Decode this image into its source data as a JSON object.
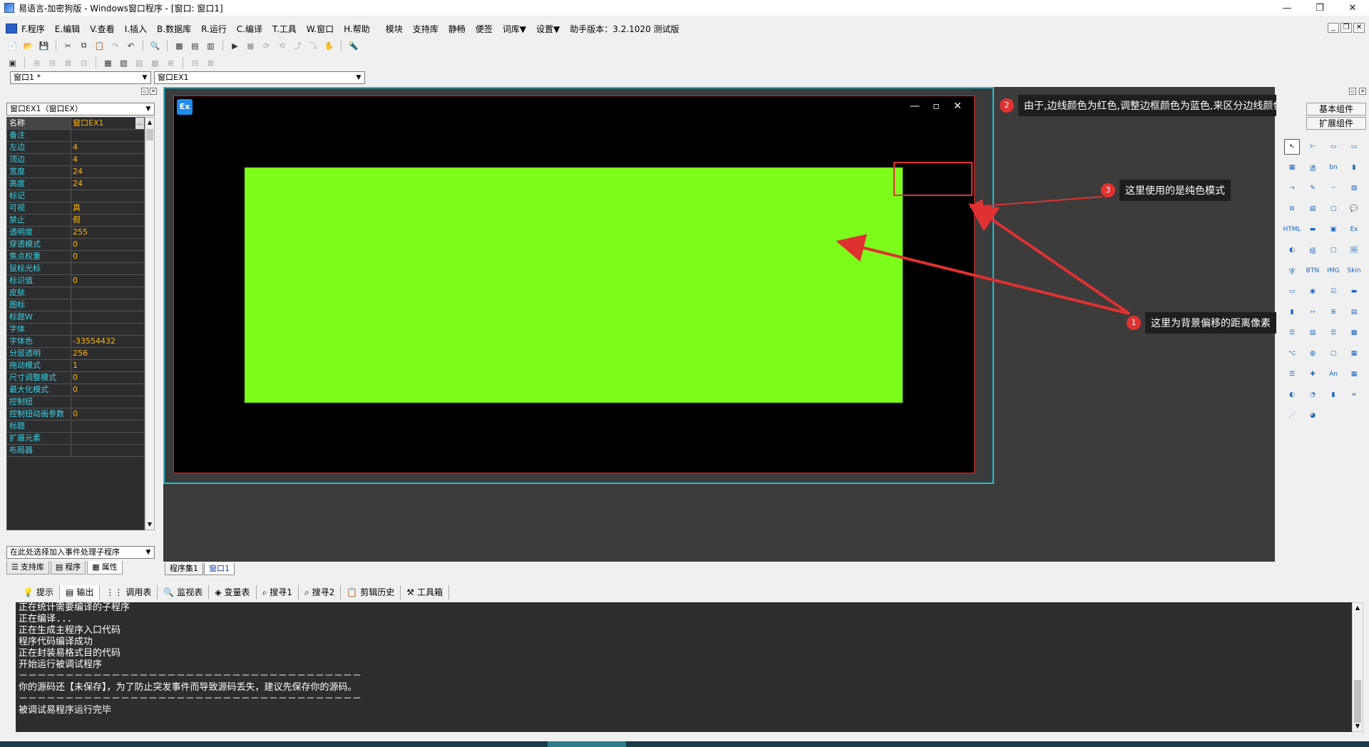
{
  "window": {
    "title": "易语言-加密狗版 - Windows窗口程序 - [窗口: 窗口1]",
    "controls": [
      "—",
      "❐",
      "✕"
    ]
  },
  "menu": {
    "items": [
      "F.程序",
      "E.编辑",
      "V.查看",
      "I.插入",
      "B.数据库",
      "R.运行",
      "C.编译",
      "T.工具",
      "W.窗口",
      "H.帮助",
      "模块",
      "支持库",
      "静畅",
      "便签",
      "词库▼",
      "设置▼",
      "助手版本：3.2.1020 测试版"
    ]
  },
  "toolbar1": [
    "📄",
    "📂",
    "💾",
    "✂",
    "⧉",
    "📋",
    "↷",
    "↶",
    "🔍",
    "▦",
    "▤",
    "▥",
    "▶",
    "■",
    "⟳",
    "⟲",
    "⤴",
    "⤵",
    "✋",
    "🔦"
  ],
  "toolbar2": [
    "▣",
    "⊞",
    "⊟",
    "⊠",
    "⊡",
    "▦",
    "▧",
    "▨",
    "▩",
    "⊞",
    "⊟",
    "⊠"
  ],
  "combos": {
    "window_select": "窗口1 *",
    "component_select": "窗口EX1"
  },
  "left_panel": {
    "object_combo": "窗口EX1（窗口EX）",
    "properties": [
      {
        "name": "名称",
        "value": "窗口EX1"
      },
      {
        "name": "备注",
        "value": ""
      },
      {
        "name": "左边",
        "value": "4"
      },
      {
        "name": "顶边",
        "value": "4"
      },
      {
        "name": "宽度",
        "value": "24"
      },
      {
        "name": "高度",
        "value": "24"
      },
      {
        "name": "标记",
        "value": ""
      },
      {
        "name": "可视",
        "value": "真"
      },
      {
        "name": "禁止",
        "value": "假"
      },
      {
        "name": "透明度",
        "value": "255"
      },
      {
        "name": "穿透模式",
        "value": "0"
      },
      {
        "name": "焦点权重",
        "value": "0"
      },
      {
        "name": "鼠标光标",
        "value": ""
      },
      {
        "name": "标识值",
        "value": "0"
      },
      {
        "name": "皮肤",
        "value": ""
      },
      {
        "name": "图标",
        "value": ""
      },
      {
        "name": "标题W",
        "value": ""
      },
      {
        "name": "字体",
        "value": ""
      },
      {
        "name": "字体色",
        "value": "-33554432"
      },
      {
        "name": "分层透明",
        "value": "256"
      },
      {
        "name": "拖动模式",
        "value": "1"
      },
      {
        "name": "尺寸调整模式",
        "value": "0"
      },
      {
        "name": "最大化模式",
        "value": "0"
      },
      {
        "name": "控制钮",
        "value": ""
      },
      {
        "name": "控制钮动画参数",
        "value": "0"
      },
      {
        "name": "标题",
        "value": ""
      },
      {
        "name": "扩展元素",
        "value": ""
      },
      {
        "name": "布局器",
        "value": ""
      }
    ],
    "event_combo": "在此处选择加入事件处理子程序",
    "tabs": [
      "支持库",
      "程序",
      "属性"
    ]
  },
  "design": {
    "window_icon_text": "Ex",
    "window_buttons": [
      "—",
      "▫",
      "✕"
    ],
    "colors": {
      "frame": "#19c2d6",
      "border": "#d22b2b",
      "background": "#000000",
      "fill": "#7cfc1a",
      "annotation": "#e03131"
    }
  },
  "doc_tabs": [
    "程序集1",
    "窗口1"
  ],
  "annotations": [
    {
      "num": "1",
      "text": "这里为背景偏移的距离像素"
    },
    {
      "num": "2",
      "text": "由于,边线颜色为红色,调整边框颜色为蓝色,来区分边线颜色"
    },
    {
      "num": "3",
      "text": "这里使用的是纯色模式"
    }
  ],
  "right_panel": {
    "tab_basic": "基本组件",
    "tab_ext": "扩展组件",
    "palette": [
      "↖",
      "⊢",
      "▭",
      "▭",
      "▦",
      "透",
      "bn",
      "▮",
      "⇢",
      "✎",
      "┄",
      "▨",
      "⧉",
      "▤",
      "▢",
      "💬",
      "HTML",
      "▬",
      "▣",
      "Ex",
      "◐",
      "组",
      "▢",
      "🖼",
      "字",
      "BTN",
      "IMG",
      "Skin",
      "▭",
      "◉",
      "☑",
      "▬",
      "▮",
      "⇿",
      "≣",
      "▤",
      "☰",
      "▤",
      "☰",
      "▩",
      "⌥",
      "◍",
      "▢",
      "▦",
      "☰",
      "✚",
      "An",
      "▦",
      "◐",
      "◔",
      "▮",
      "≈",
      "⋰",
      "◕"
    ]
  },
  "output": {
    "tabs": [
      "提示",
      "输出",
      "调用表",
      "监视表",
      "变量表",
      "搜寻1",
      "搜寻2",
      "剪辑历史",
      "工具箱"
    ],
    "active_tab": "输出",
    "lines": [
      "正在统计需要编译的子程序",
      "正在编译...",
      "正在生成主程序入口代码",
      "程序代码编译成功",
      "正在封装易格式目的代码",
      "开始运行被调试程序",
      "－－－－－－－－－－－－－－－－－－－－－－－－－－－－－－－－－－－－－",
      "你的源码还【未保存】，为了防止突发事件而导致源码丢失，建议先保存你的源码。",
      "－－－－－－－－－－－－－－－－－－－－－－－－－－－－－－－－－－－－－",
      "被调试易程序运行完毕"
    ]
  }
}
